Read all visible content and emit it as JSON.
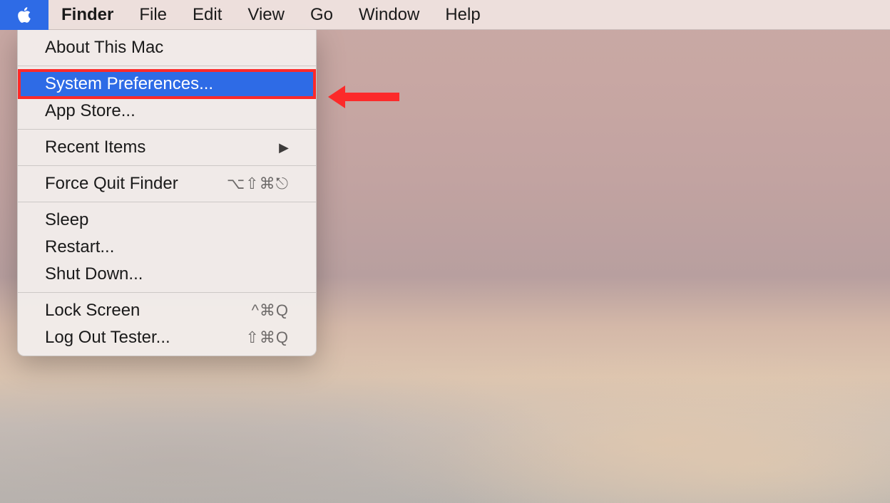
{
  "menubar": {
    "active_app": "Finder",
    "items": [
      "File",
      "Edit",
      "View",
      "Go",
      "Window",
      "Help"
    ]
  },
  "apple_menu": {
    "items": [
      {
        "label": "About This Mac",
        "shortcut": "",
        "submenu": false,
        "highlighted": false,
        "separator_after": true
      },
      {
        "label": "System Preferences...",
        "shortcut": "",
        "submenu": false,
        "highlighted": true,
        "separator_after": false
      },
      {
        "label": "App Store...",
        "shortcut": "",
        "submenu": false,
        "highlighted": false,
        "separator_after": true
      },
      {
        "label": "Recent Items",
        "shortcut": "",
        "submenu": true,
        "highlighted": false,
        "separator_after": true
      },
      {
        "label": "Force Quit Finder",
        "shortcut": "⌥⇧⌘⎋",
        "submenu": false,
        "highlighted": false,
        "separator_after": true
      },
      {
        "label": "Sleep",
        "shortcut": "",
        "submenu": false,
        "highlighted": false,
        "separator_after": false
      },
      {
        "label": "Restart...",
        "shortcut": "",
        "submenu": false,
        "highlighted": false,
        "separator_after": false
      },
      {
        "label": "Shut Down...",
        "shortcut": "",
        "submenu": false,
        "highlighted": false,
        "separator_after": true
      },
      {
        "label": "Lock Screen",
        "shortcut": "^⌘Q",
        "submenu": false,
        "highlighted": false,
        "separator_after": false
      },
      {
        "label": "Log Out Tester...",
        "shortcut": "⇧⌘Q",
        "submenu": false,
        "highlighted": false,
        "separator_after": false
      }
    ]
  },
  "colors": {
    "highlight": "#2e6be6",
    "annotation": "#fc2a2a"
  }
}
